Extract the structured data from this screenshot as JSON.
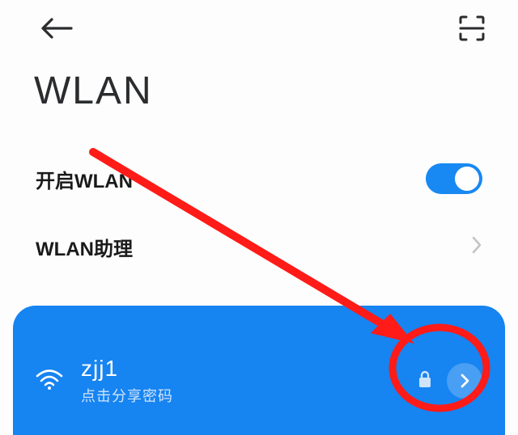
{
  "header": {
    "back_label": "back",
    "scan_label": "scan-qr"
  },
  "page_title": "WLAN",
  "rows": {
    "wlan_enable_label": "开启WLAN",
    "wlan_assistant_label": "WLAN助理"
  },
  "toggle": {
    "wlan_on": true
  },
  "connected": {
    "ssid": "zjj1",
    "share_hint": "点击分享密码"
  },
  "colors": {
    "accent": "#1889f2",
    "card": "#1684f1",
    "annotation": "#ff1b18"
  }
}
